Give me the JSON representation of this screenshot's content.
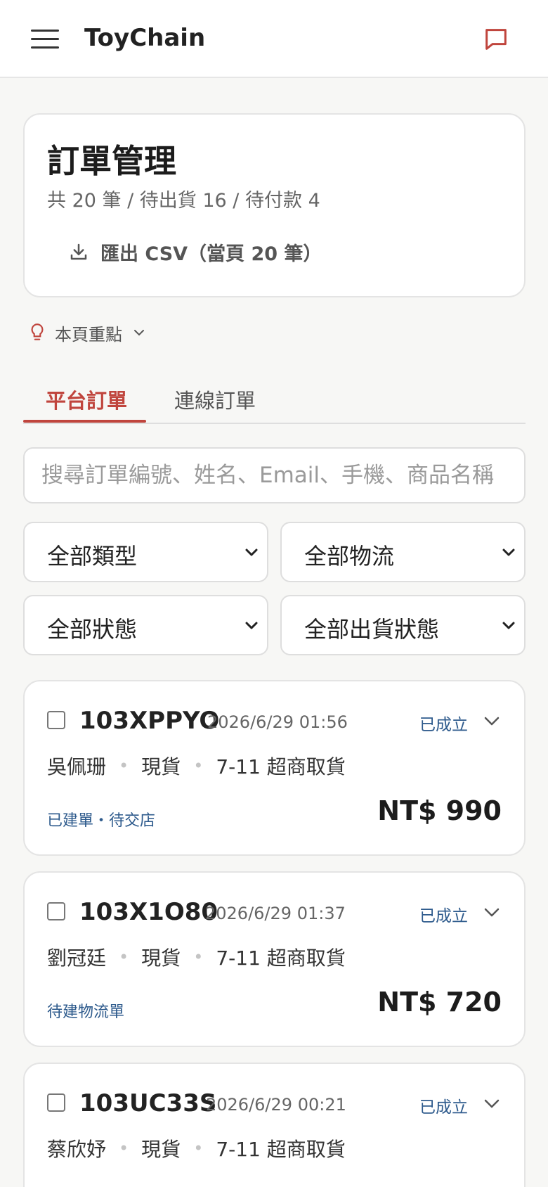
{
  "app": {
    "title": "ToyChain"
  },
  "header": {
    "title": "訂單管理",
    "summary": "共 20 筆 / 待出貨 16 / 待付款 4",
    "export_label": "匯出 CSV（當頁 20 筆）"
  },
  "highlights": {
    "label": "本頁重點"
  },
  "tabs": [
    {
      "label": "平台訂單",
      "active": true
    },
    {
      "label": "連線訂單",
      "active": false
    }
  ],
  "search": {
    "placeholder": "搜尋訂單編號、姓名、Email、手機、商品名稱",
    "value": ""
  },
  "filters": {
    "type": "全部類型",
    "logistics": "全部物流",
    "status": "全部狀態",
    "shipping_status": "全部出貨狀態"
  },
  "orders": [
    {
      "id": "103XPPYO",
      "date": "2026/6/29 01:56",
      "status": "已成立",
      "name": "吳佩珊",
      "stock": "現貨",
      "delivery": "7-11 超商取貨",
      "shipping": "已建單・待交店",
      "price": "NT$ 990"
    },
    {
      "id": "103X1O80",
      "date": "2026/6/29 01:37",
      "status": "已成立",
      "name": "劉冠廷",
      "stock": "現貨",
      "delivery": "7-11 超商取貨",
      "shipping": "待建物流單",
      "price": "NT$ 720"
    },
    {
      "id": "103UC33S",
      "date": "2026/6/29 00:21",
      "status": "已成立",
      "name": "蔡欣妤",
      "stock": "現貨",
      "delivery": "7-11 超商取貨",
      "shipping": "",
      "price": ""
    }
  ],
  "colors": {
    "accent": "#c0453d",
    "link_blue": "#2d5a8c",
    "background": "#f7f7f5"
  },
  "icons": [
    "menu-icon",
    "chat-icon",
    "download-icon",
    "lightbulb-icon",
    "chevron-down-icon"
  ]
}
